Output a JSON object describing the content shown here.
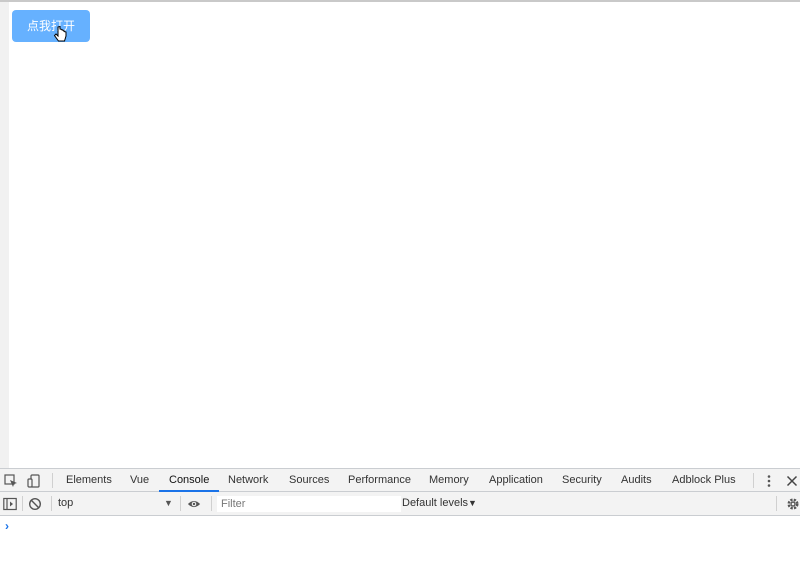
{
  "page": {
    "button_label": "点我打开"
  },
  "devtools": {
    "tabs": [
      {
        "label": "Elements",
        "active": false
      },
      {
        "label": "Vue",
        "active": false
      },
      {
        "label": "Console",
        "active": true
      },
      {
        "label": "Network",
        "active": false
      },
      {
        "label": "Sources",
        "active": false
      },
      {
        "label": "Performance",
        "active": false
      },
      {
        "label": "Memory",
        "active": false
      },
      {
        "label": "Application",
        "active": false
      },
      {
        "label": "Security",
        "active": false
      },
      {
        "label": "Audits",
        "active": false
      },
      {
        "label": "Adblock Plus",
        "active": false
      }
    ],
    "console": {
      "context": "top",
      "filter_placeholder": "Filter",
      "filter_value": "",
      "levels": "Default levels",
      "prompt": "›"
    },
    "accent_color": "#1a73e8"
  },
  "colors": {
    "button_bg": "#66b1ff",
    "button_text": "#ffffff"
  },
  "icons": [
    "inspect-icon",
    "device-toggle-icon",
    "more-vert-icon",
    "close-icon",
    "sidebar-toggle-icon",
    "clear-console-icon",
    "eye-icon",
    "gear-icon",
    "pointer-cursor-icon"
  ]
}
